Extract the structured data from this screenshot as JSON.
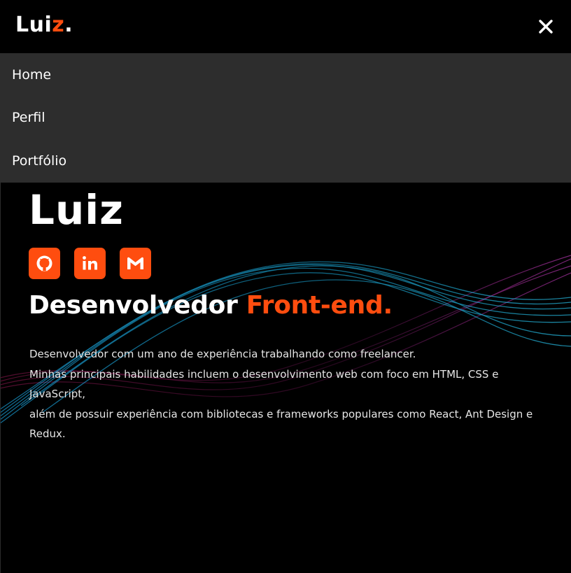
{
  "brand": {
    "logo_text": "Lui",
    "logo_accent": "z",
    "logo_dot": ".",
    "accent_color": "#ff4d0f"
  },
  "header": {
    "close_icon": "close-icon"
  },
  "menu": {
    "items": [
      {
        "label": "Home"
      },
      {
        "label": "Perfil"
      },
      {
        "label": "Portfólio"
      }
    ]
  },
  "hero": {
    "name": "Luiz",
    "socials": [
      {
        "icon": "github-icon"
      },
      {
        "icon": "linkedin-icon"
      },
      {
        "icon": "gmail-icon"
      }
    ],
    "headline_main": "Desenvolvedor",
    "headline_accent": "Front-end.",
    "bio_lines": [
      "Desenvolvedor com um ano de experiência trabalhando como freelancer.",
      "Minhas principais habilidades incluem o desenvolvimento web com foco em HTML, CSS e JavaScript,",
      "além de possuir experiência com bibliotecas e frameworks populares como React, Ant Design e Redux."
    ]
  }
}
